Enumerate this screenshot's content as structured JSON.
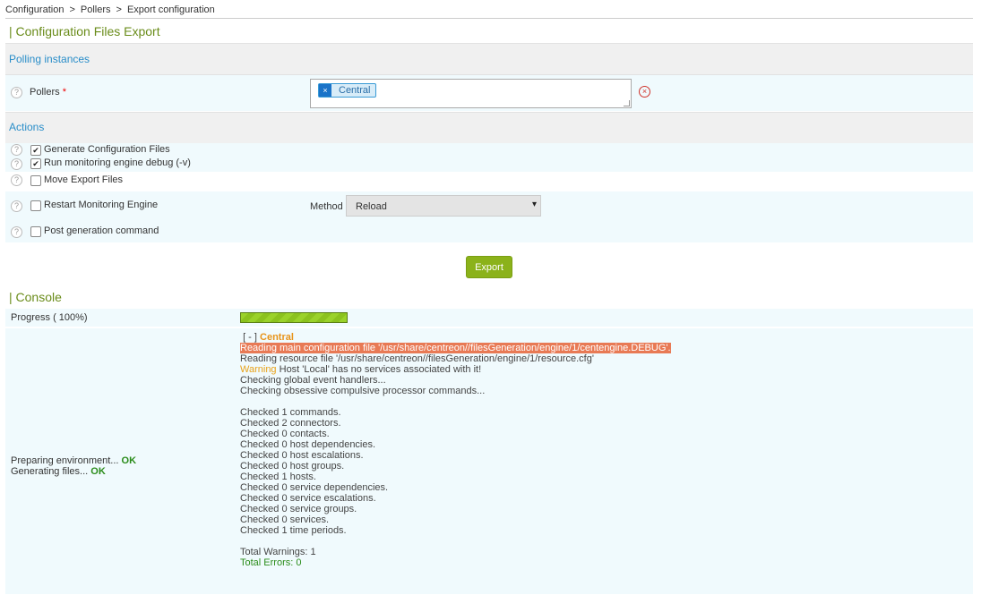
{
  "breadcrumb": {
    "item1": "Configuration",
    "sep": ">",
    "item2": "Pollers",
    "item3": "Export configuration"
  },
  "page_title": "| Configuration Files Export",
  "polling_instances": {
    "section_title": "Polling instances",
    "help_glyph": "?",
    "pollers_label": "Pollers",
    "required_mark": "*",
    "selected_tag": "Central",
    "tag_remove_glyph": "×",
    "clear_glyph": "×"
  },
  "actions": {
    "section_title": "Actions",
    "check_glyph": "✔",
    "items": [
      {
        "label": "Generate Configuration Files",
        "checked": true
      },
      {
        "label": "Run monitoring engine debug (-v)",
        "checked": true
      },
      {
        "label": "Move Export Files",
        "checked": false
      },
      {
        "label": "Restart Monitoring Engine",
        "checked": false
      },
      {
        "label": "Post generation command",
        "checked": false
      }
    ],
    "method_label": "Method",
    "method_value": "Reload",
    "dropdown_glyph": "▾"
  },
  "export_button": "Export",
  "console": {
    "title": "| Console",
    "progress_label": "Progress ( 100%)",
    "progress": 1.0,
    "prep_text": "Preparing environment...",
    "prep_status": "OK",
    "gen_text": "Generating files...",
    "gen_status": "OK",
    "toggle": "[ - ]",
    "poller_name": "Central",
    "line_debug": "Reading main configuration file '/usr/share/centreon//filesGeneration/engine/1/centengine.DEBUG'.",
    "line_resource": "Reading resource file '/usr/share/centreon//filesGeneration/engine/1/resource.cfg'",
    "warning_label": "Warning",
    "warning_text": " Host 'Local' has no services associated with it!",
    "line_event": "Checking global event handlers...",
    "line_obsessive": "Checking obsessive compulsive processor commands...",
    "checks": [
      "Checked 1 commands.",
      "Checked 2 connectors.",
      "Checked 0 contacts.",
      "Checked 0 host dependencies.",
      "Checked 0 host escalations.",
      "Checked 0 host groups.",
      "Checked 1 hosts.",
      "Checked 0 service dependencies.",
      "Checked 0 service escalations.",
      "Checked 0 service groups.",
      "Checked 0 services.",
      "Checked 1 time periods."
    ],
    "total_warnings": "Total Warnings: 1",
    "total_errors": "Total Errors: 0"
  },
  "colors": {
    "accent_green": "#6a8c1a",
    "link_blue": "#2a8ec9",
    "button_green": "#8bb21a",
    "error_highlight": "#e87a55",
    "warning_orange": "#e8a21a",
    "ok_green": "#2a8c1a"
  }
}
